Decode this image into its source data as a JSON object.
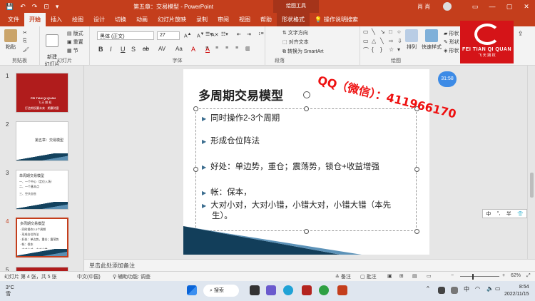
{
  "titlebar": {
    "title": "第五章：交易模型  -  PowerPoint",
    "context_tab": "绘图工具",
    "user": "肖 肖",
    "quick_access": [
      "💾",
      "↶",
      "↷",
      "⊡",
      "▾"
    ]
  },
  "tabs": [
    "文件",
    "开始",
    "插入",
    "绘图",
    "设计",
    "切换",
    "动画",
    "幻灯片放映",
    "录制",
    "审阅",
    "视图",
    "帮助",
    "形状格式",
    "操作说明搜索"
  ],
  "active_tab": "开始",
  "ribbon": {
    "paste": "粘贴",
    "new_slide": "新建\n幻灯片",
    "layout": "版式",
    "reset": "重置",
    "section": "节",
    "font_name": "黑体 (正文)",
    "font_size": "27",
    "text_direction": "文字方向",
    "align_text": "对齐文本",
    "smartart": "转换为 SmartArt",
    "arrange": "排列",
    "quick_styles": "快速样式",
    "shape_fill": "形状",
    "groups": {
      "clipboard": "剪贴板",
      "slides": "幻灯片",
      "font": "字体",
      "paragraph": "段落",
      "drawing": "绘图"
    },
    "format_buttons": [
      "B",
      "I",
      "U",
      "S",
      "ab",
      "AV",
      "Aa",
      "A",
      "A"
    ]
  },
  "logo": {
    "line1": "FEI TIAN QI QUAN",
    "line2": "飞 天 期 权"
  },
  "thumbnails": [
    {
      "num": "1",
      "lines": [
        "FEI TIAN QI QUAN",
        "飞 天 期 权",
        "打造期权赢未来 · 期赢财富"
      ]
    },
    {
      "num": "2",
      "lines": [
        "第五章：交易模型"
      ]
    },
    {
      "num": "3",
      "lines": [
        "单周期交易模型",
        "一、一个中心（定位入场）",
        "二、一个基本点",
        "三、空头加仓"
      ]
    },
    {
      "num": "4",
      "lines": [
        "多周期交易模型",
        "· 同时操作2-3个周期",
        "· 形成仓位阵法",
        "· 好处：单边势，重仓；震荡势",
        "· 帐：保本",
        "· 大对小对，大对小错"
      ]
    },
    {
      "num": "5",
      "lines": []
    }
  ],
  "slide": {
    "title": "多周期交易模型",
    "bullets": [
      "同时操作2-3个周期",
      "形成仓位阵法",
      "好处：单边势，重仓；震荡势，锁仓+收益增强",
      "帐：保本，",
      "大对小对，大对小错，小错大对，小错大错（本先",
      "生）。"
    ]
  },
  "watermark": "QQ（微信）：411966170",
  "timer": "31:58",
  "ime": [
    "中",
    "°,",
    "半",
    "👕"
  ],
  "notes_placeholder": "单击此处添加备注",
  "status": {
    "slide_info": "幻灯片 第 4 张，共 5 张",
    "language": "中文(中国)",
    "accessibility": "辅助功能: 调查",
    "notes": "备注",
    "comments": "批注",
    "zoom": "62%"
  },
  "taskbar": {
    "temp": "3°C",
    "weather": "雪",
    "search": "搜索",
    "time": "8:54",
    "date": "2022/11/15"
  },
  "colors": {
    "accent": "#c43e1c",
    "watermark": "#ee1010",
    "logo": "#d51418"
  }
}
